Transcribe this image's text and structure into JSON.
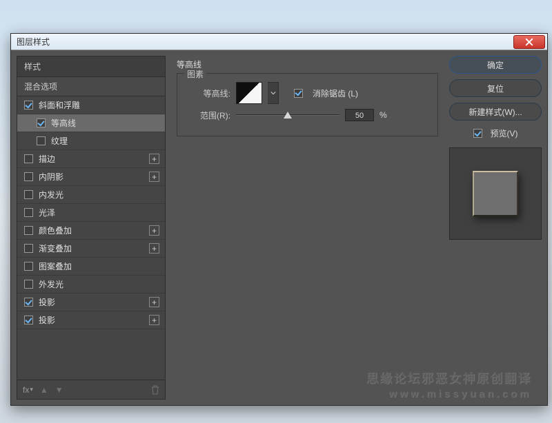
{
  "dialog": {
    "title": "图层样式"
  },
  "sidebar": {
    "header": "样式",
    "subheader": "混合选项",
    "items": [
      {
        "label": "斜面和浮雕",
        "checked": true,
        "addable": false,
        "indent": false
      },
      {
        "label": "等高线",
        "checked": true,
        "addable": false,
        "indent": true,
        "selected": true
      },
      {
        "label": "纹理",
        "checked": false,
        "addable": false,
        "indent": true
      },
      {
        "label": "描边",
        "checked": false,
        "addable": true
      },
      {
        "label": "内阴影",
        "checked": false,
        "addable": true
      },
      {
        "label": "内发光",
        "checked": false,
        "addable": false
      },
      {
        "label": "光泽",
        "checked": false,
        "addable": false
      },
      {
        "label": "颜色叠加",
        "checked": false,
        "addable": true
      },
      {
        "label": "渐变叠加",
        "checked": false,
        "addable": true
      },
      {
        "label": "图案叠加",
        "checked": false,
        "addable": false
      },
      {
        "label": "外发光",
        "checked": false,
        "addable": false
      },
      {
        "label": "投影",
        "checked": true,
        "addable": true
      },
      {
        "label": "投影",
        "checked": true,
        "addable": true
      }
    ],
    "fx_label": "fx"
  },
  "panel": {
    "title": "等高线",
    "legend": "图素",
    "contour_label": "等高线:",
    "antialias_label": "消除锯齿 (L)",
    "antialias_checked": true,
    "range_label": "范围(R):",
    "range_value": "50",
    "range_unit": "%",
    "range_percent": 50
  },
  "buttons": {
    "ok": "确定",
    "cancel": "复位",
    "newstyle": "新建样式(W)...",
    "preview": "预览(V)",
    "preview_checked": true
  },
  "watermark": {
    "line1": "思缘论坛邪恶女神原创翻译",
    "line2": "www.missyuan.com"
  }
}
